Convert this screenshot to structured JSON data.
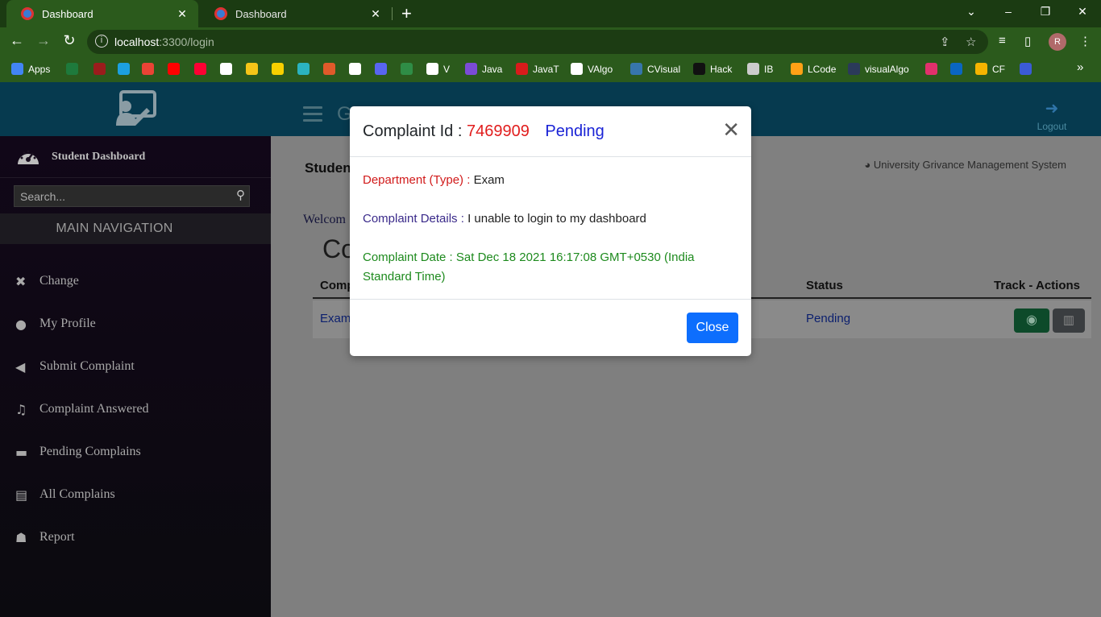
{
  "browser": {
    "tabs": [
      {
        "title": "Dashboard"
      },
      {
        "title": "Dashboard"
      }
    ],
    "url_host": "localhost",
    "url_rest": ":3300/login",
    "avatar_letter": "R"
  },
  "bookmarks": [
    {
      "label": "Apps",
      "color": "#4285f4"
    },
    {
      "label": "",
      "color": "#1e7a3c"
    },
    {
      "label": "",
      "color": "#9b1c1c"
    },
    {
      "label": "",
      "color": "#1ca0e0"
    },
    {
      "label": "",
      "color": "#ea4335"
    },
    {
      "label": "",
      "color": "#ff0000"
    },
    {
      "label": "",
      "color": "#ff0033"
    },
    {
      "label": "",
      "color": "#ffffff"
    },
    {
      "label": "",
      "color": "#f5c518"
    },
    {
      "label": "",
      "color": "#f7d000"
    },
    {
      "label": "",
      "color": "#2bb3c0"
    },
    {
      "label": "",
      "color": "#e05a2a"
    },
    {
      "label": "",
      "color": "#ffffff"
    },
    {
      "label": "",
      "color": "#5865f2"
    },
    {
      "label": "",
      "color": "#2f8d46"
    },
    {
      "label": "V",
      "color": "#ffffff"
    },
    {
      "label": "Java",
      "color": "#7b4bd6"
    },
    {
      "label": "JavaT",
      "color": "#d81b1b"
    },
    {
      "label": "VAlgo",
      "color": "#ffffff"
    },
    {
      "label": "CVisual",
      "color": "#3776ab"
    },
    {
      "label": "Hack",
      "color": "#111111"
    },
    {
      "label": "IB",
      "color": "#cccccc"
    },
    {
      "label": "LCode",
      "color": "#ffa116"
    },
    {
      "label": "visualAlgo",
      "color": "#2b3a5a"
    },
    {
      "label": "",
      "color": "#e1306c"
    },
    {
      "label": "",
      "color": "#0a66c2"
    },
    {
      "label": "CF",
      "color": "#f4b400"
    },
    {
      "label": "",
      "color": "#3b5bd6"
    }
  ],
  "header": {
    "brand_partial": "G",
    "logout_label": "Logout"
  },
  "sidebar": {
    "title": "Student Dashboard",
    "search_placeholder": "Search...",
    "nav_heading": "MAIN NAVIGATION",
    "items": [
      {
        "label": "Change",
        "icon": "tools-icon"
      },
      {
        "label": "My Profile",
        "icon": "user-icon"
      },
      {
        "label": "Submit Complaint",
        "icon": "megaphone-icon"
      },
      {
        "label": "Complaint Answered",
        "icon": "bell-icon"
      },
      {
        "label": "Pending Complains",
        "icon": "truck-icon"
      },
      {
        "label": "All Complains",
        "icon": "clipboard-icon"
      },
      {
        "label": "Report",
        "icon": "users-icon"
      }
    ]
  },
  "content": {
    "heading_partial": "Studen",
    "system_name": "University Grivance Management System",
    "welcome_partial": "Welcom",
    "page_title_partial": "Co",
    "table": {
      "col1_partial": "Comp",
      "col_status": "Status",
      "col_actions": "Track - Actions",
      "row": {
        "col1_partial": "Exam",
        "status": "Pending"
      }
    }
  },
  "modal": {
    "title_prefix": "Complaint Id :",
    "complaint_id": "7469909",
    "status": "Pending",
    "department_label": "Department (Type)",
    "department_value": "Exam",
    "details_label": "Complaint Details",
    "details_value": "I unable to login to my dashboard",
    "date_label": "Complaint Date",
    "date_value": "Sat Dec 18 2021 16:17:08 GMT+0530 (India Standard Time)",
    "close_label": "Close"
  },
  "colors": {
    "modal_id": "#e11d1d",
    "modal_status": "#1a23d6",
    "close_button": "#0d6efd",
    "header_bg": "#063a4f"
  }
}
